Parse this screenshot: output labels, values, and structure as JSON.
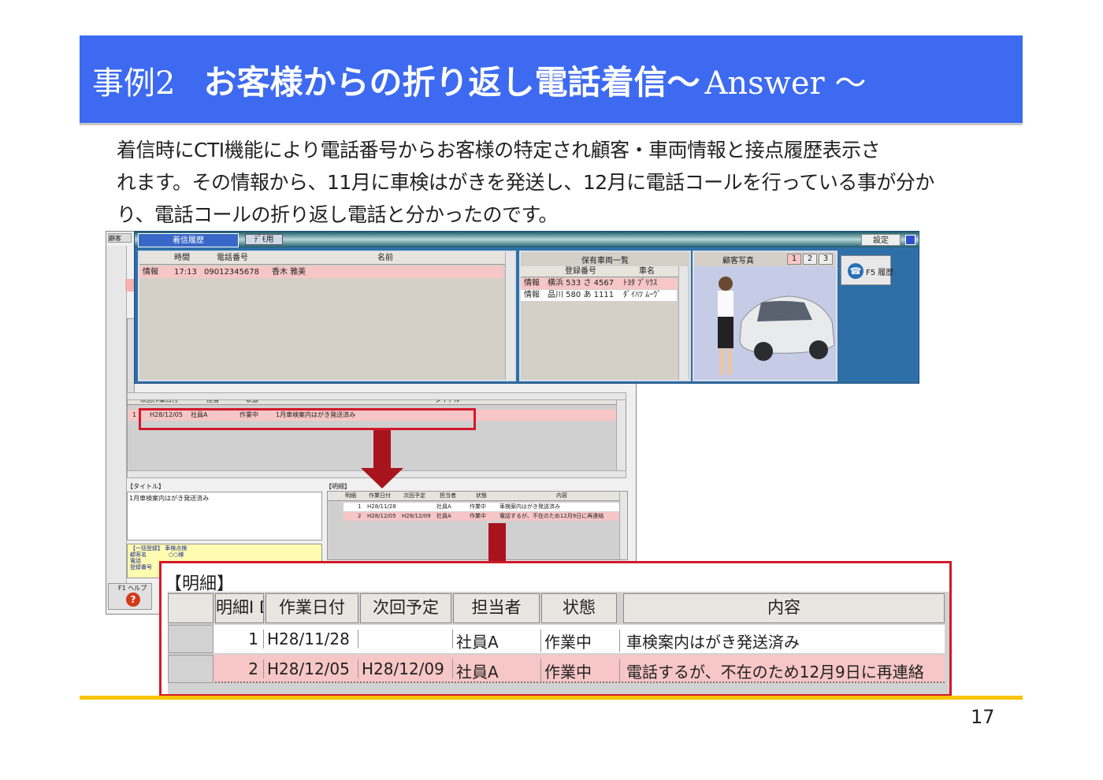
{
  "slide": {
    "case_label": "事例2",
    "title": "お客様からの折り返し電話着信～",
    "answer": "Answer ～",
    "body": [
      "着信時にCTI機能により電話番号からお客様の特定され顧客・車両情報と接点履歴表示さ",
      "れます。その情報から、11月に車検はがきを発送し、12月に電話コールを行っている事が分か",
      "り、電話コールの折り返し電話と分かったのです。"
    ],
    "page_number": "17"
  },
  "colors": {
    "banner": "#3d6af0",
    "footer_line": "#f7c400",
    "highlight": "#d11a2a",
    "arrow": "#a8141e",
    "pink_row": "#f7c6c6"
  },
  "call_window": {
    "tabs": [
      "着信履歴",
      "ﾃﾞﾓ用"
    ],
    "settings": "設定",
    "headers": [
      "時間",
      "電話番号",
      "名前"
    ],
    "row": {
      "label": "情報",
      "time": "17:13",
      "phone": "09012345678",
      "name": "香木 雅美"
    },
    "vehicle_title": "保有車両一覧",
    "vehicle_headers": [
      "登録番号",
      "車名"
    ],
    "vehicles": [
      {
        "label": "情報",
        "reg": "横浜 533 さ 4567",
        "car": "ﾄﾖﾀ ﾌﾟﾘｳｽ"
      },
      {
        "label": "情報",
        "reg": "品川 580 あ 1111",
        "car": "ﾀﾞｲﾊﾂ ﾑｰｳﾞ"
      }
    ],
    "photo_title": "顧客写真",
    "photo_tabs": [
      "1",
      "2",
      "3"
    ],
    "history_button": "F5 履歴"
  },
  "back_window": {
    "left_tab": "顧客",
    "history_headers": [
      "次回作業日付",
      "担当",
      "状態",
      "タイトル"
    ],
    "history_row": {
      "no": "1",
      "date": "H28/12/05",
      "staff": "社員A",
      "status": "作業中",
      "title": "1月車検案内はがき発送済み"
    },
    "title_label": "【タイトル】",
    "title_text": "1月車検案内はがき発送済み",
    "detail_label": "【明細】",
    "detail_headers": [
      "明細",
      "作業日付",
      "次回予定",
      "担当者",
      "状態",
      "内容"
    ],
    "detail_rows": [
      {
        "no": "1",
        "date": "H28/11/28",
        "next": "",
        "staff": "社員A",
        "status": "作業中",
        "content": "車検案内はがき発送済み"
      },
      {
        "no": "2",
        "date": "H28/12/05",
        "next": "H28/12/09",
        "staff": "社員A",
        "status": "作業中",
        "content": "電話するが、不在のため12月9日に再連絡"
      }
    ],
    "note_lines": [
      "【一括登録】 車検点検",
      "顧客名　　　　○○様",
      "電話",
      "登録番号"
    ],
    "f1_label": "F1 ヘルプ"
  },
  "zoom_detail": {
    "label": "【明細】",
    "headers": [
      "明細I D",
      "作業日付",
      "次回予定",
      "担当者",
      "状態",
      "内容"
    ],
    "rows": [
      {
        "no": "1",
        "date": "H28/11/28",
        "next": "",
        "staff": "社員A",
        "status": "作業中",
        "content": "車検案内はがき発送済み"
      },
      {
        "no": "2",
        "date": "H28/12/05",
        "next": "H28/12/09",
        "staff": "社員A",
        "status": "作業中",
        "content": "電話するが、不在のため12月9日に再連絡"
      }
    ]
  }
}
